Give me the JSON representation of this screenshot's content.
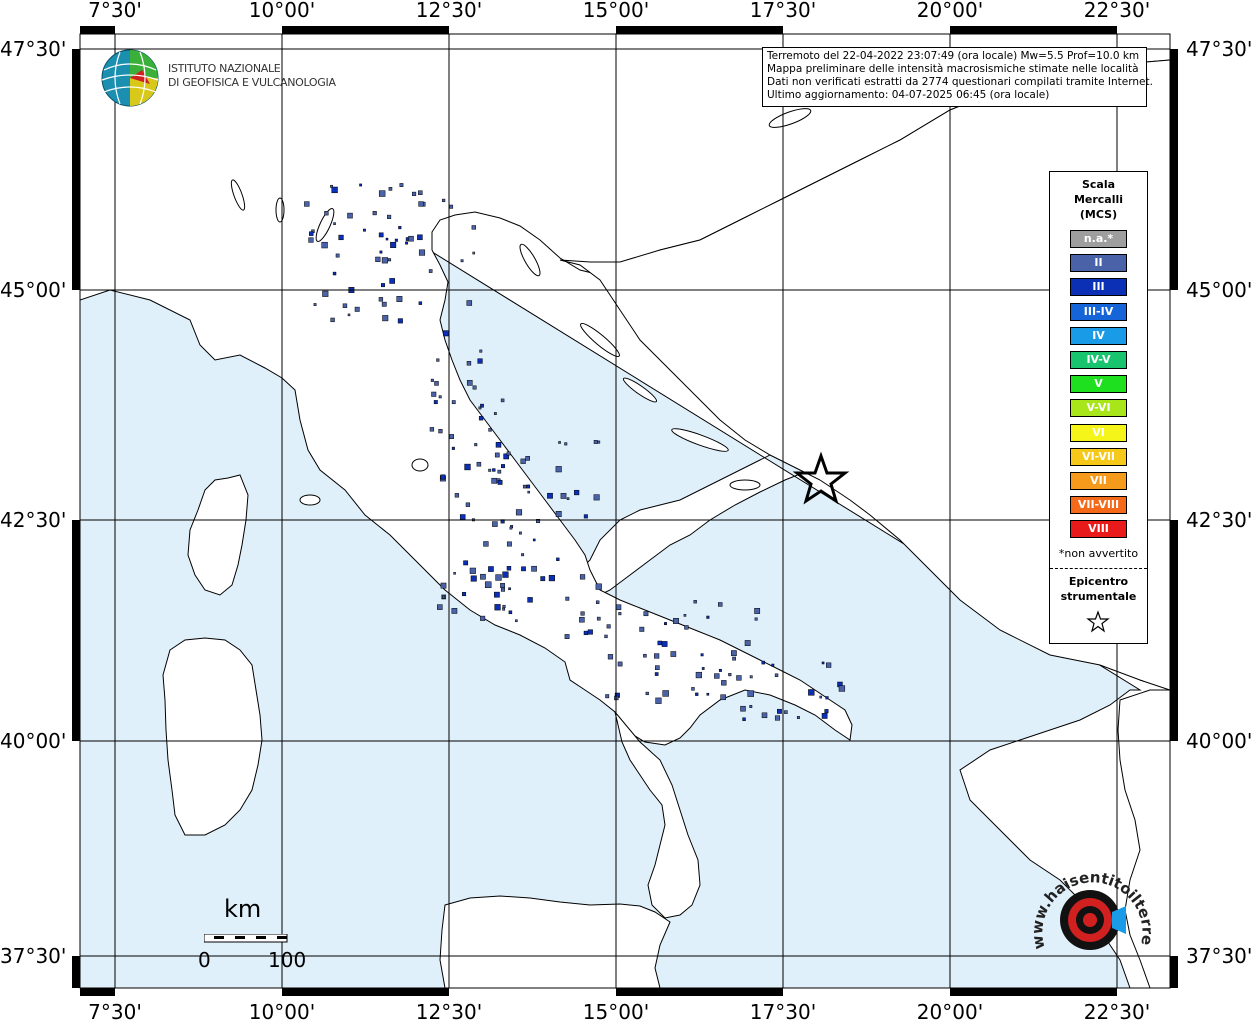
{
  "map": {
    "lon_ticks": [
      "7°30'",
      "10°00'",
      "12°30'",
      "15°00'",
      "17°30'",
      "20°00'",
      "22°30'"
    ],
    "lat_ticks": [
      "47°30'",
      "45°00'",
      "42°30'",
      "40°00'",
      "37°30'"
    ],
    "sea_color": "#e0f0fb",
    "land_color": "#ffffff",
    "epicenter": {
      "lat": 42.7,
      "lon": 18.0
    }
  },
  "info": {
    "line1": "Terremoto del 22-04-2022 23:07:49 (ora locale) Mw=5.5 Prof=10.0 km",
    "line2": "Mappa preliminare delle intensità macrosismiche stimate nelle località",
    "line3": "Dati non verificati estratti da 2774 questionari compilati tramite Internet.",
    "line4": "Ultimo aggiornamento: 04-07-2025 06:45 (ora locale)"
  },
  "legend": {
    "title_line1": "Scala",
    "title_line2": "Mercalli",
    "title_line3": "(MCS)",
    "items": [
      {
        "label": "n.a.*",
        "color": "#9e9e9e"
      },
      {
        "label": "II",
        "color": "#4a62a8"
      },
      {
        "label": "III",
        "color": "#0b2fb5"
      },
      {
        "label": "III-IV",
        "color": "#1565d8"
      },
      {
        "label": "IV",
        "color": "#1a9be8"
      },
      {
        "label": "IV-V",
        "color": "#19c46e"
      },
      {
        "label": "V",
        "color": "#1ee01e"
      },
      {
        "label": "V-VI",
        "color": "#a8e61a"
      },
      {
        "label": "VI",
        "color": "#f5f51a"
      },
      {
        "label": "VI-VII",
        "color": "#f5c81a"
      },
      {
        "label": "VII",
        "color": "#f59a1a"
      },
      {
        "label": "VII-VIII",
        "color": "#f56a1a"
      },
      {
        "label": "VIII",
        "color": "#e81a1a"
      }
    ],
    "note": "*non avvertito",
    "epicenter_line1": "Epicentro",
    "epicenter_line2": "strumentale"
  },
  "ingv": {
    "line1": "ISTITUTO NAZIONALE",
    "line2": "DI GEOFISICA E VULCANOLOGIA"
  },
  "scale": {
    "unit": "km",
    "start": "0",
    "end": "100"
  },
  "site_logo_text": "www.haisentitoilterremoto.it"
}
